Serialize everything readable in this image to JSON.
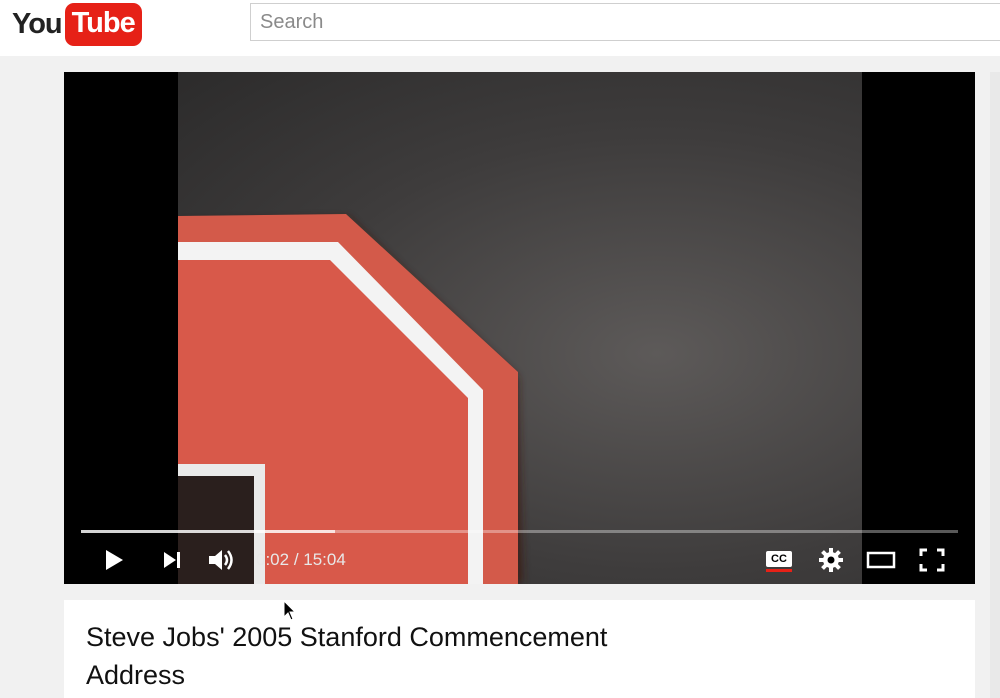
{
  "masthead": {
    "logo": {
      "you": "You",
      "tube": "Tube"
    },
    "search": {
      "placeholder": "Search"
    }
  },
  "player": {
    "progress": 0.29,
    "time": {
      "current": "0:02",
      "separator": " / ",
      "duration": "15:04"
    },
    "controls": [
      "play-icon",
      "next-icon",
      "volume-icon",
      "cc-icon",
      "settings-gear-icon",
      "theater-mode-icon",
      "fullscreen-icon"
    ],
    "cc": {
      "label": "CC",
      "active_color": "#e62117"
    }
  },
  "video": {
    "title": "Steve Jobs' 2005 Stanford Commencement Address"
  },
  "colors": {
    "brand": "#e62117",
    "page_bg": "#f1f1f1",
    "stop_sign_red": "#d8594a"
  }
}
